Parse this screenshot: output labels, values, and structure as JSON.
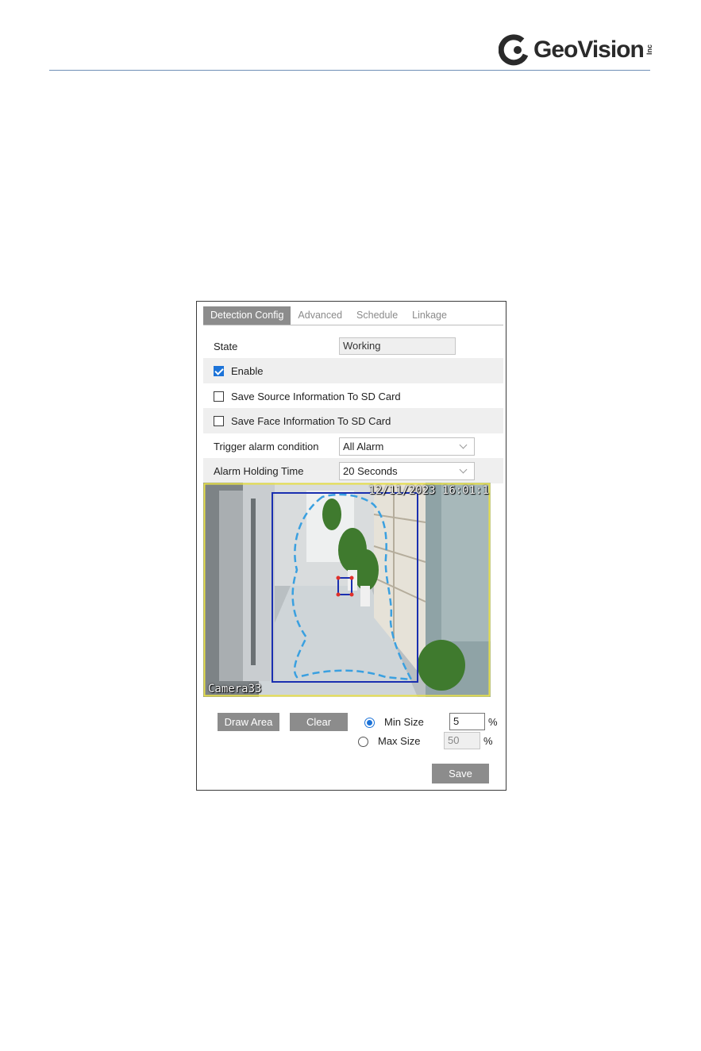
{
  "brand": {
    "name": "GeoVision",
    "suffix": "Inc"
  },
  "tabs": [
    {
      "label": "Detection Config",
      "active": true
    },
    {
      "label": "Advanced",
      "active": false
    },
    {
      "label": "Schedule",
      "active": false
    },
    {
      "label": "Linkage",
      "active": false
    }
  ],
  "form": {
    "state_label": "State",
    "state_value": "Working",
    "enable_label": "Enable",
    "enable_checked": true,
    "save_source_label": "Save Source Information To SD Card",
    "save_source_checked": false,
    "save_face_label": "Save Face Information To SD Card",
    "save_face_checked": false,
    "trigger_label": "Trigger alarm condition",
    "trigger_value": "All Alarm",
    "holding_label": "Alarm Holding Time",
    "holding_value": "20 Seconds"
  },
  "video": {
    "timestamp": "12/11/2023 16:01:1",
    "camera_name": "Camera33"
  },
  "controls": {
    "draw_area_label": "Draw Area",
    "clear_label": "Clear",
    "min_size_label": "Min Size",
    "min_size_value": "5",
    "min_size_selected": true,
    "max_size_label": "Max Size",
    "max_size_value": "50",
    "max_size_selected": false,
    "percent_sign": "%",
    "save_label": "Save"
  },
  "colors": {
    "tab_active_bg": "#8c8c8c",
    "checkbox_checked": "#1c73d8",
    "detection_area": "#1a2fb0",
    "face_trace": "#3aa0e0",
    "frame_border": "#e8e04a",
    "header_rule": "#6f8fb7"
  }
}
